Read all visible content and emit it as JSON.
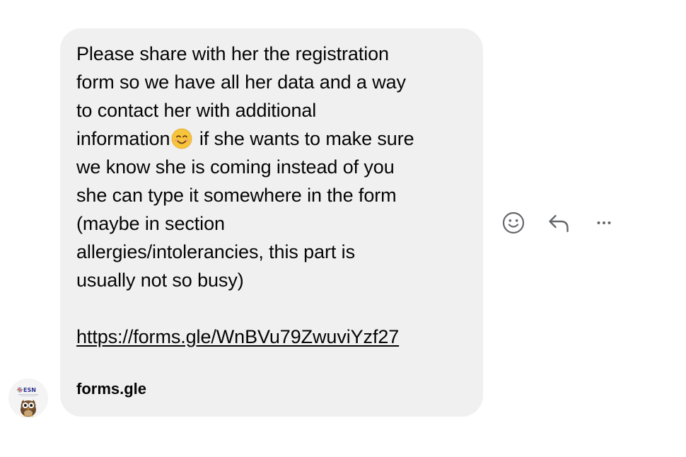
{
  "message": {
    "text_part1": "Please share with her the registration\nform so we have all her data and a way\nto contact her with additional\ninformation",
    "emoji": "smiling-face-with-smiling-eyes",
    "text_part2": " if she wants to make sure\nwe know she is coming instead of you\nshe can type it somewhere in the form\n(maybe in section\nallergies/intolerancies, this part is\nusually not so busy)",
    "link": "https://forms.gle/WnBVu79ZwuviYzf27",
    "link_domain": "forms.gle"
  },
  "avatar": {
    "label": "ESN"
  },
  "actions": {
    "react": "smiley-icon",
    "reply": "reply-icon",
    "more": "more-icon"
  },
  "colors": {
    "bubble": "#f0f0f0",
    "text": "#050505",
    "icon": "#65676b"
  }
}
